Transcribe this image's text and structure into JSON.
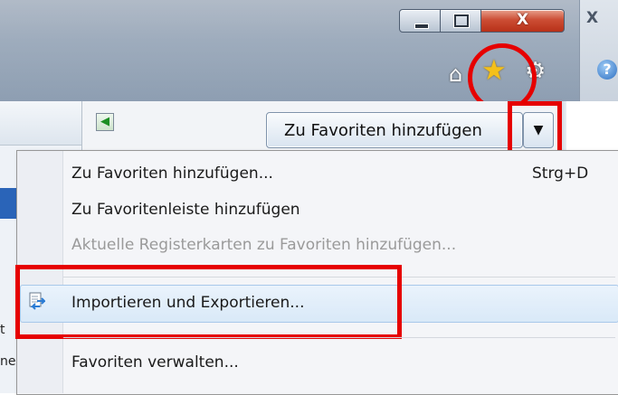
{
  "window": {
    "close_label": "X",
    "close2_label": "X",
    "help_label": "?"
  },
  "toolbar": {
    "home_icon": "home-icon",
    "favorites_icon": "star-icon",
    "tools_icon": "gear-icon"
  },
  "favorites_panel": {
    "add_button_label": "Zu Favoriten hinzufügen",
    "dropdown_glyph": "▼",
    "back_glyph": "◆"
  },
  "left_pane": {
    "partial_text_1": "t",
    "partial_text_2": "ne"
  },
  "menu": {
    "items": [
      {
        "label": "Zu Favoriten hinzufügen...",
        "shortcut": "Strg+D",
        "enabled": true
      },
      {
        "label": "Zu Favoritenleiste hinzufügen",
        "enabled": true
      },
      {
        "label": "Aktuelle Registerkarten zu Favoriten hinzufügen...",
        "enabled": false
      },
      {
        "label": "Importieren und Exportieren...",
        "enabled": true,
        "highlighted": true
      },
      {
        "label": "Favoriten verwalten...",
        "enabled": true
      }
    ]
  },
  "colors": {
    "annotation_red": "#e60000",
    "menu_bg": "#f4f5f8",
    "highlight_bg": "#d9e9f8"
  }
}
